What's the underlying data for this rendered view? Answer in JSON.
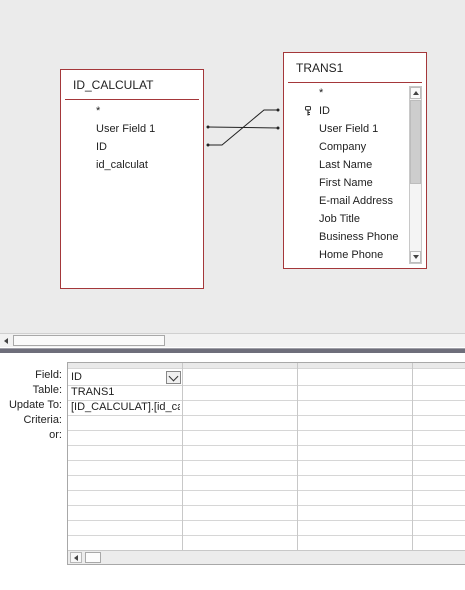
{
  "tables": {
    "id_calculat": {
      "title": "ID_CALCULAT",
      "fields": [
        "*",
        "User Field 1",
        "ID",
        "id_calculat"
      ]
    },
    "trans1": {
      "title": "TRANS1",
      "fields": [
        "*",
        "ID",
        "User Field 1",
        "Company",
        "Last Name",
        "First Name",
        "E-mail Address",
        "Job Title",
        "Business Phone",
        "Home Phone"
      ],
      "primary_key_field": "ID"
    }
  },
  "grid": {
    "row_labels": [
      "Field:",
      "Table:",
      "Update To:",
      "Criteria:",
      "or:"
    ],
    "column1": {
      "field": "ID",
      "table": "TRANS1",
      "update_to": "[ID_CALCULAT].[id_cal"
    }
  },
  "colors": {
    "table_border": "#a4373a",
    "design_background": "#ebebeb",
    "splitter": "#6e6e7a"
  },
  "icons": [
    "key-icon",
    "scroll-up-arrow-icon",
    "scroll-down-arrow-icon",
    "scroll-left-arrow-icon",
    "dropdown-chevron-icon"
  ]
}
